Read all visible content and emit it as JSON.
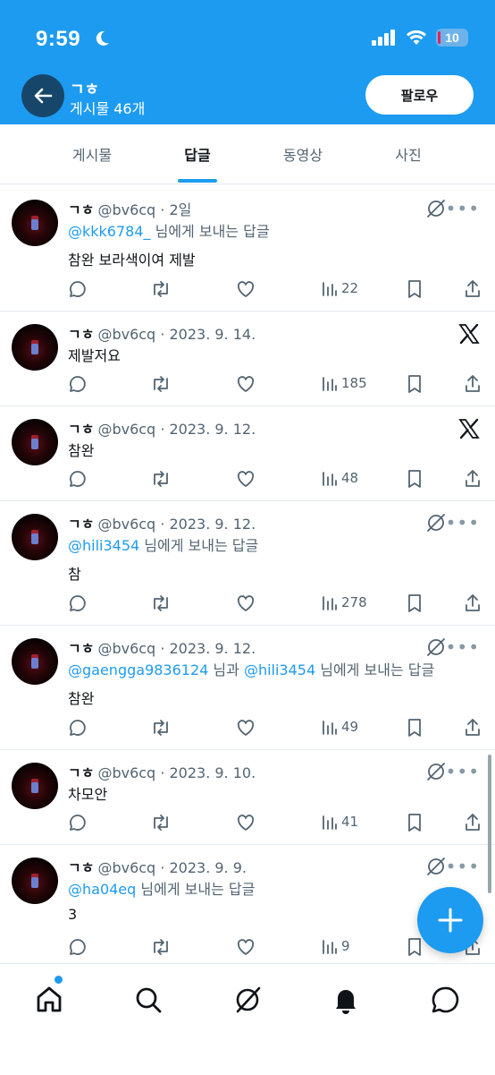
{
  "status": {
    "time": "9:59",
    "battery": "10"
  },
  "profile": {
    "name": "ㄱㅎ",
    "post_count": "게시물 46개",
    "follow_label": "팔로우"
  },
  "tabs": [
    "게시물",
    "답글",
    "동영상",
    "사진"
  ],
  "active_tab": "답글",
  "tweets": [
    {
      "name": "ㄱㅎ",
      "handle": "@bv6cq",
      "date": "· 2일",
      "reply_prefix": "",
      "mentions": [
        "@kkk6784_"
      ],
      "joiner": "",
      "reply_suffix": " 님에게 보내는 답글",
      "text": "참완 보라색이여 제발",
      "views": "22",
      "corner_icon": "grok-icon"
    },
    {
      "name": "ㄱㅎ",
      "handle": "@bv6cq",
      "date": "· 2023. 9. 14.",
      "mentions": [],
      "text": "제발저요",
      "views": "185",
      "corner_icon": "x-logo-icon"
    },
    {
      "name": "ㄱㅎ",
      "handle": "@bv6cq",
      "date": "· 2023. 9. 12.",
      "mentions": [],
      "text": "참완",
      "views": "48",
      "corner_icon": "x-logo-icon"
    },
    {
      "name": "ㄱㅎ",
      "handle": "@bv6cq",
      "date": "· 2023. 9. 12.",
      "mentions": [
        "@hili3454"
      ],
      "joiner": "",
      "reply_suffix": " 님에게 보내는 답글",
      "text": "참",
      "views": "278",
      "corner_icon": "grok-icon"
    },
    {
      "name": "ㄱㅎ",
      "handle": "@bv6cq",
      "date": "· 2023. 9. 12.",
      "mentions": [
        "@gaengga9836124",
        "@hili3454"
      ],
      "joiner": " 님과 ",
      "reply_suffix": " 님에게 보내는 답글",
      "text": "참완",
      "views": "49",
      "corner_icon": "grok-icon"
    },
    {
      "name": "ㄱㅎ",
      "handle": "@bv6cq",
      "date": "· 2023. 9. 10.",
      "mentions": [],
      "text": "차모안",
      "views": "41",
      "corner_icon": "grok-icon"
    },
    {
      "name": "ㄱㅎ",
      "handle": "@bv6cq",
      "date": "· 2023. 9. 9.",
      "mentions": [
        "@ha04eq"
      ],
      "joiner": "",
      "reply_suffix": " 님에게 보내는 답글",
      "text": "3",
      "views": "9",
      "corner_icon": "grok-icon"
    }
  ],
  "bottom_nav": [
    "home-icon",
    "search-icon",
    "grok-icon",
    "notifications-icon",
    "messages-icon"
  ],
  "colors": {
    "accent": "#1d9bf0",
    "text": "#0f1419",
    "muted": "#536471"
  }
}
